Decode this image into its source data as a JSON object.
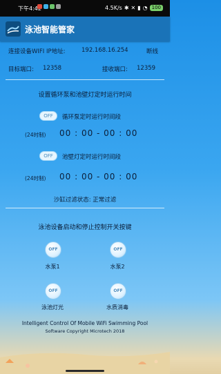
{
  "status": {
    "time": "下午4:42",
    "speed": "4.5K/s",
    "battery": "100",
    "icon_colors": [
      "#e14b3b",
      "#3fb0e8",
      "#6cc36b",
      "#9a9a9a"
    ]
  },
  "app": {
    "title": "泳池智能管家"
  },
  "connection": {
    "label": "连接设备WIFI IP地址:",
    "ip": "192.168.16.254",
    "state": "断线",
    "target_port_label": "目标端口:",
    "target_port": "12358",
    "recv_port_label": "接收端口:",
    "recv_port": "12359"
  },
  "timer_section": {
    "title": "设置循环泵和池壁灯定时运行时间",
    "pump": {
      "toggle": "OFF",
      "label": "循环泵定时运行时间段",
      "clock_label": "(24时制)",
      "times": "00 : 00 - 00 : 00"
    },
    "light": {
      "toggle": "OFF",
      "label": "池壁灯定时运行时间段",
      "clock_label": "(24时制)",
      "times": "00 : 00 - 00 : 00"
    },
    "filter_status": "沙缸过滤状态: 正常过滤"
  },
  "control_section": {
    "title": "泳池设备启动和停止控制开关按键",
    "buttons": [
      {
        "state": "OFF",
        "label": "水泵1"
      },
      {
        "state": "OFF",
        "label": "水泵2"
      },
      {
        "state": "OFF",
        "label": "泳池灯光"
      },
      {
        "state": "OFF",
        "label": "水质消毒"
      }
    ]
  },
  "footer": {
    "line1": "Intelligent Control Of Mobile WiFi Swimming Pool",
    "line2": "Software Copyright Microtech 2018"
  }
}
